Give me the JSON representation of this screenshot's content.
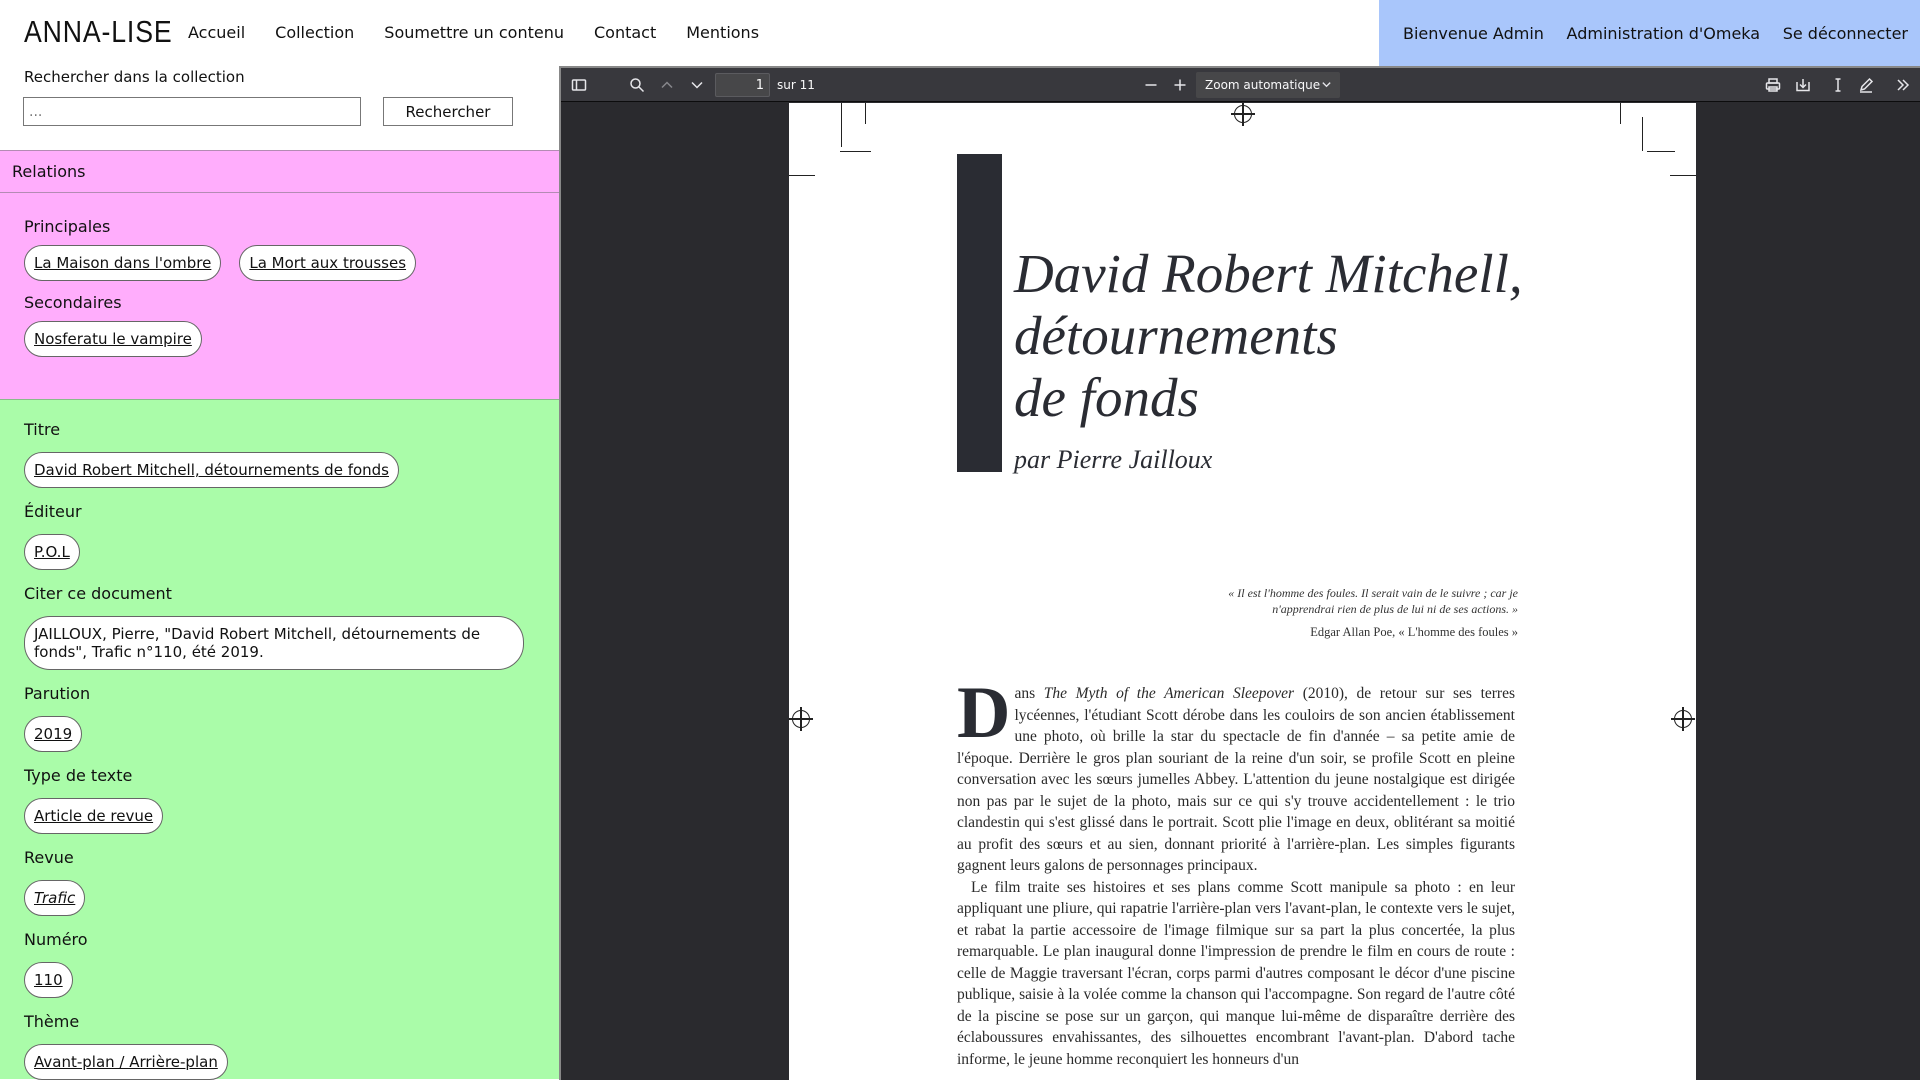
{
  "site": {
    "brand": "ANNA-LISE",
    "nav": [
      "Accueil",
      "Collection",
      "Soumettre un contenu",
      "Contact",
      "Mentions"
    ],
    "admin": [
      "Bienvenue Admin",
      "Administration d'Omeka",
      "Se déconnecter"
    ],
    "colors": {
      "admin_bar": "#a9c6fb",
      "relations_bg": "#ffadfc",
      "metadata_bg": "#aafca9"
    }
  },
  "search": {
    "label": "Rechercher dans la collection",
    "placeholder": "...",
    "button": "Rechercher"
  },
  "relations": {
    "heading": "Relations",
    "principal_label": "Principales",
    "principal": [
      "La Maison dans l'ombre",
      "La Mort aux trousses"
    ],
    "secondary_label": "Secondaires",
    "secondary": [
      "Nosferatu le vampire"
    ]
  },
  "metadata": {
    "title_label": "Titre",
    "title": "David Robert Mitchell, détournements de fonds",
    "publisher_label": "Éditeur",
    "publisher": "P.O.L",
    "cite_label": "Citer ce document",
    "cite": "JAILLOUX, Pierre, \"David Robert Mitchell, détournements de fonds\", Trafic n°110, été 2019.",
    "year_label": "Parution",
    "year": "2019",
    "type_label": "Type de texte",
    "type": "Article de revue",
    "review_label": "Revue",
    "review": "Trafic",
    "issue_label": "Numéro",
    "issue": "110",
    "theme_label": "Thème",
    "theme": "Avant-plan / Arrière-plan"
  },
  "viewer": {
    "page": "1",
    "page_count": "sur 11",
    "zoom": "Zoom automatique",
    "icons": [
      "sidebar-toggle-icon",
      "search-icon",
      "previous-page-icon",
      "next-page-icon",
      "zoom-out-icon",
      "zoom-in-icon",
      "print-icon",
      "download-icon",
      "text-cursor-icon",
      "pen-icon",
      "more-tools-icon"
    ]
  },
  "document": {
    "title_lines": [
      "David Robert Mitchell,",
      "détournements",
      "de fonds"
    ],
    "author": "par Pierre Jailloux",
    "epigraph": "« Il est l'homme des foules. Il serait vain de le suivre ; car je n'apprendrai rien de plus de lui ni de ses actions. »",
    "epigraph_source": "Edgar Allan Poe, « L'homme des foules »",
    "dropcap": "D",
    "paragraph1_start": "ans ",
    "paragraph1_film": "The Myth of the American Sleepover",
    "paragraph1_rest": " (2010), de retour sur ses terres lycéennes, l'étudiant Scott dérobe dans les couloirs de son ancien établissement une photo, où brille la star du spectacle de fin d'année – sa petite amie de l'époque. Derrière le gros plan souriant de la reine d'un soir, se profile Scott en pleine conversation avec les sœurs jumelles Abbey. L'attention du jeune nostalgique est dirigée non pas par le sujet de la photo, mais sur ce qui s'y trouve accidentellement : le trio clandestin qui s'est glissé dans le portrait. Scott plie l'image en deux, oblitérant sa moitié au profit des sœurs et au sien, donnant priorité à l'arrière-plan. Les simples figurants gagnent leurs galons de personnages principaux.",
    "paragraph2": "Le film traite ses histoires et ses plans comme Scott manipule sa photo : en leur appliquant une pliure, qui rapatrie l'arrière-plan vers l'avant-plan, le contexte vers le sujet, et rabat la partie accessoire de l'image filmique sur sa part la plus concertée, la plus remarquable. Le plan inaugural donne l'impression de prendre le film en cours de route : celle de Maggie traversant l'écran, corps parmi d'autres composant le décor d'une piscine publique, saisie à la volée comme la chanson qui l'accompagne. Son regard de l'autre côté de la piscine se pose sur un garçon, qui manque lui-même de disparaître derrière des éclaboussures envahissantes, des silhouettes encombrant l'avant-plan. D'abord tache informe, le jeune homme reconquiert les honneurs d'un"
  }
}
